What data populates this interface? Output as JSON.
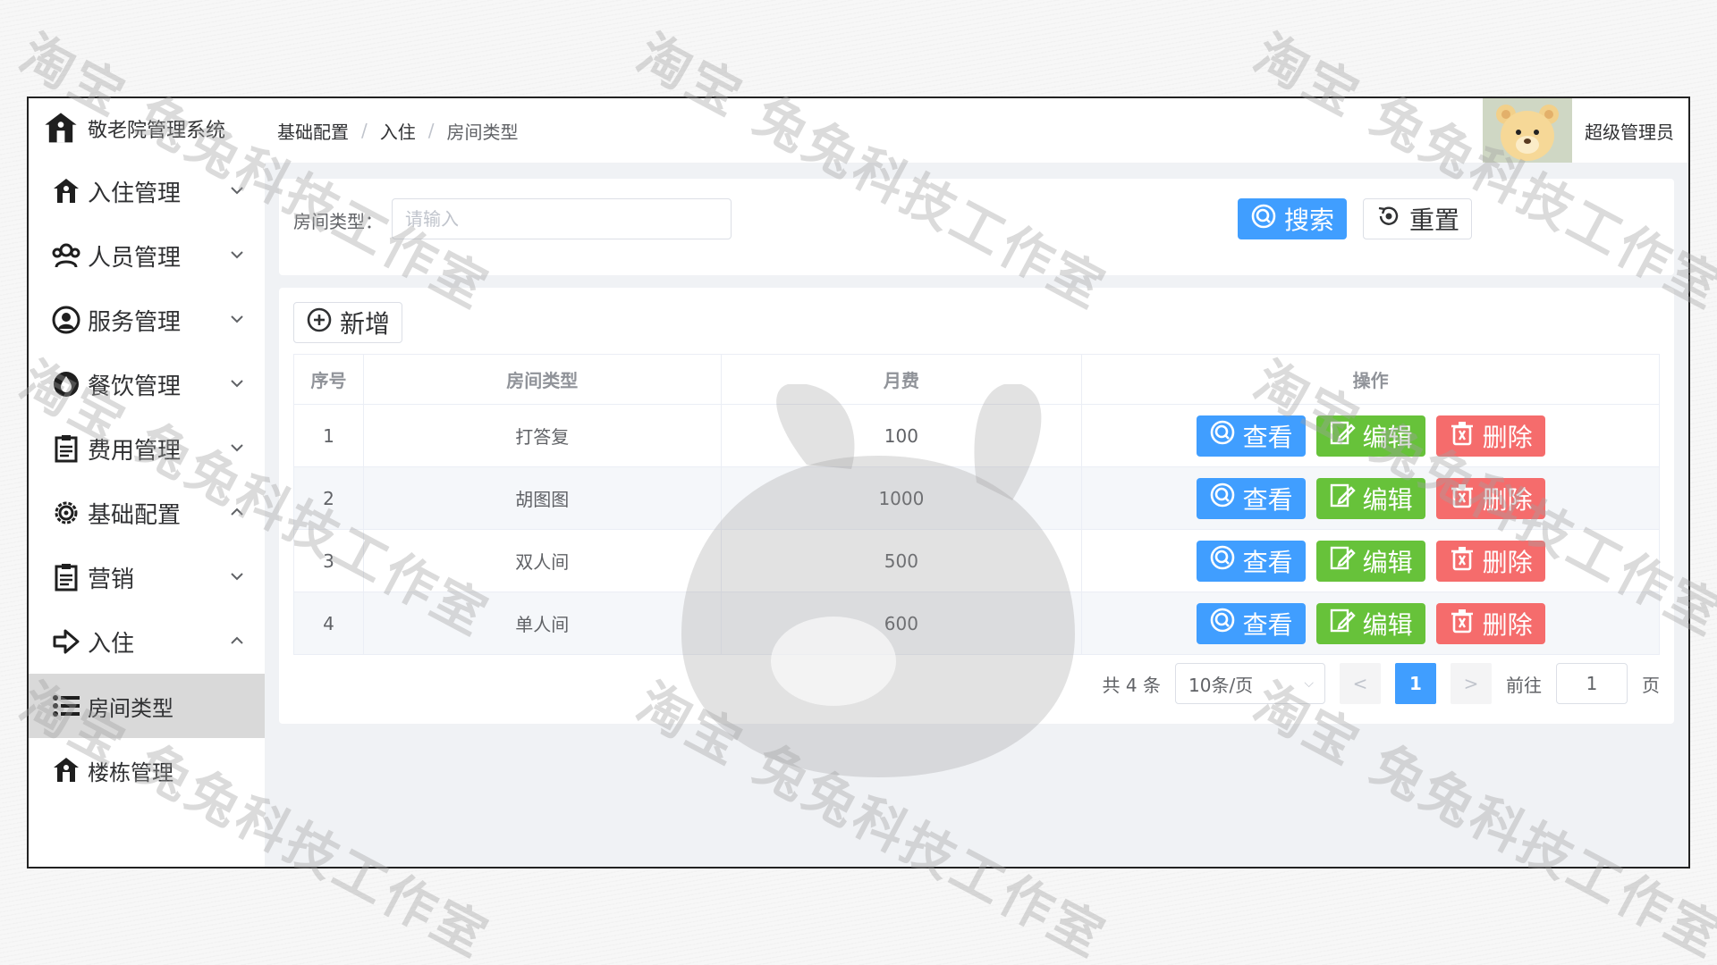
{
  "app": {
    "title": "敬老院管理系统",
    "brand_icon": "home-icon"
  },
  "sidebar": {
    "items": [
      {
        "label": "入住管理",
        "icon": "home-icon",
        "chevron": "v"
      },
      {
        "label": "人员管理",
        "icon": "users-icon",
        "chevron": "v"
      },
      {
        "label": "服务管理",
        "icon": "user-circle-icon",
        "chevron": "v"
      },
      {
        "label": "餐饮管理",
        "icon": "drop-icon",
        "chevron": "v"
      },
      {
        "label": "费用管理",
        "icon": "clipboard-icon",
        "chevron": "v"
      },
      {
        "label": "基础配置",
        "icon": "gear-icon",
        "chevron": "^"
      },
      {
        "label": "营销",
        "icon": "clipboard-icon",
        "chevron": "v"
      },
      {
        "label": "入住",
        "icon": "enter-icon",
        "chevron": "^"
      },
      {
        "label": "房间类型",
        "icon": "list-icon",
        "active": true
      },
      {
        "label": "楼栋管理",
        "icon": "home-icon"
      }
    ]
  },
  "breadcrumb": [
    "基础配置",
    "入住",
    "房间类型"
  ],
  "breadcrumb_sep": "/",
  "user": {
    "name": "超级管理员"
  },
  "search": {
    "label": "房间类型：",
    "placeholder": "请输入",
    "search_label": "搜索",
    "reset_label": "重置"
  },
  "toolbar": {
    "add_label": "新增"
  },
  "table": {
    "columns": [
      "序号",
      "房间类型",
      "月费",
      "操作"
    ],
    "rows": [
      {
        "index": "1",
        "type": "打答复",
        "fee": "100"
      },
      {
        "index": "2",
        "type": "胡图图",
        "fee": "1000"
      },
      {
        "index": "3",
        "type": "双人间",
        "fee": "500"
      },
      {
        "index": "4",
        "type": "单人间",
        "fee": "600"
      }
    ],
    "actions": {
      "view": "查看",
      "edit": "编辑",
      "delete": "删除"
    }
  },
  "pagination": {
    "total_text": "共 4 条",
    "page_size": "10条/页",
    "prev": "<",
    "current_page": "1",
    "next": ">",
    "goto_label": "前往",
    "goto_value": "1",
    "page_suffix": "页"
  },
  "watermark": {
    "text": "淘宝 兔兔科技工作室"
  },
  "colors": {
    "primary": "#409eff",
    "success": "#67c23a",
    "danger": "#f56c6c"
  }
}
